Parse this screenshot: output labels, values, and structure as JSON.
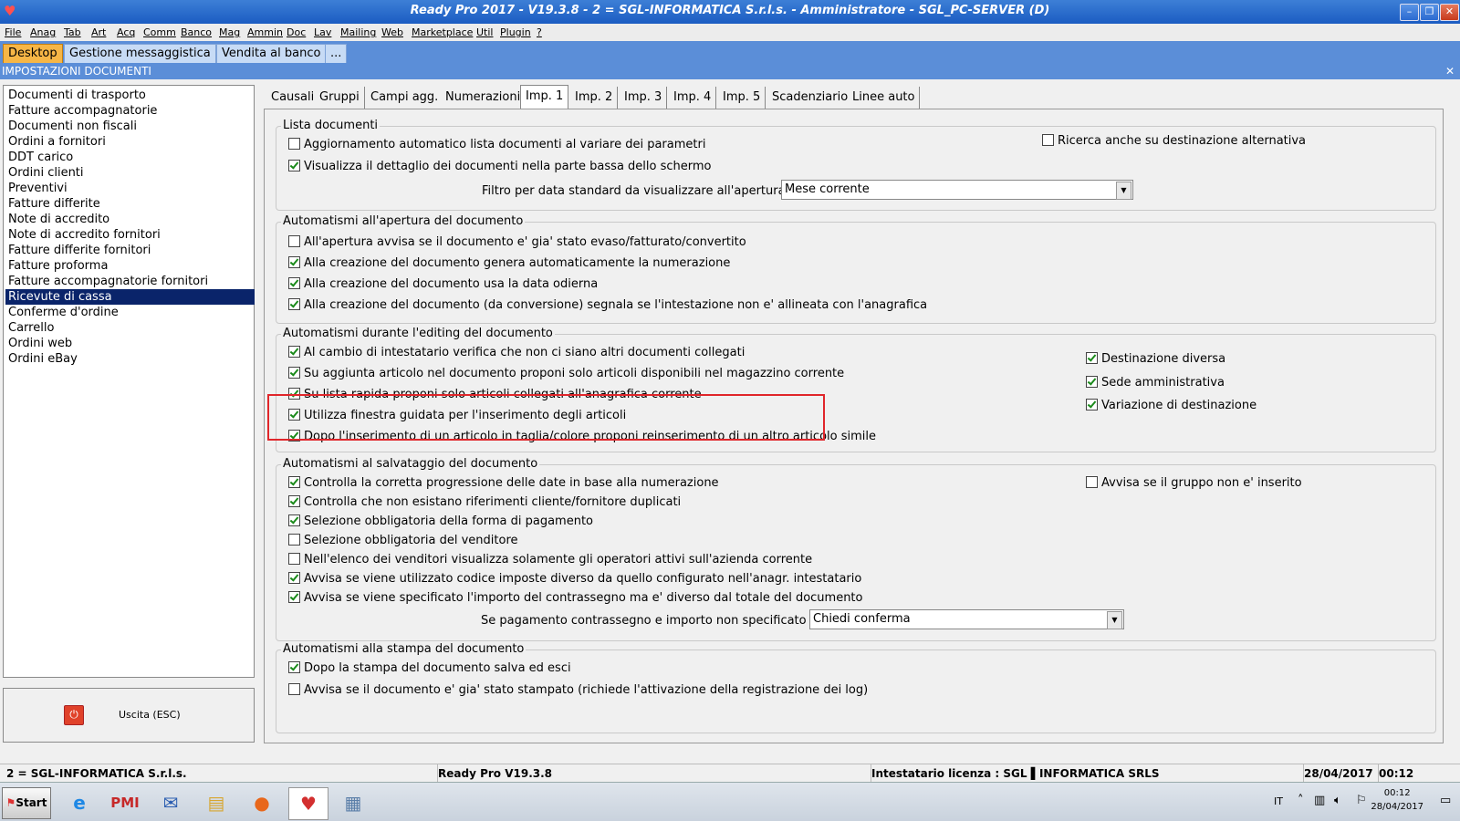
{
  "window": {
    "title": "Ready Pro 2017 - V19.3.8 - 2 = SGL-INFORMATICA S.r.l.s. - Amministratore - SGL_PC-SERVER (D)"
  },
  "menu": [
    "File",
    "Anag",
    "Tab",
    "Art",
    "Acq",
    "Comm",
    "Banco",
    "Mag",
    "Ammin",
    "Doc",
    "Lav",
    "Mailing",
    "Web",
    "Marketplace",
    "Util",
    "Plugin",
    "?"
  ],
  "top_tabs": [
    "Desktop",
    "Gestione messaggistica",
    "Vendita al banco",
    "..."
  ],
  "section_title": "IMPOSTAZIONI DOCUMENTI",
  "doc_list": [
    "Documenti di trasporto",
    "Fatture accompagnatorie",
    "Documenti non fiscali",
    "Ordini a fornitori",
    "DDT carico",
    "Ordini clienti",
    "Preventivi",
    "Fatture differite",
    "Note di accredito",
    "Note di accredito fornitori",
    "Fatture differite fornitori",
    "Fatture proforma",
    "Fatture accompagnatorie fornitori",
    "Ricevute di cassa",
    "Conferme d'ordine",
    "Carrello",
    "Ordini web",
    "Ordini eBay"
  ],
  "selected_doc": "Ricevute di cassa",
  "exit_label": "Uscita (ESC)",
  "panel_tabs": [
    "Causali",
    "Gruppi",
    "Campi agg.",
    "Numerazioni",
    "Imp. 1",
    "Imp. 2",
    "Imp. 3",
    "Imp. 4",
    "Imp. 5",
    "Scadenziario",
    "Linee auto"
  ],
  "groups": {
    "lista": {
      "label": "Lista documenti",
      "opts": [
        {
          "label": "Aggiornamento automatico lista documenti al variare dei parametri",
          "checked": false
        },
        {
          "label": "Visualizza il dettaglio dei documenti nella parte bassa dello schermo",
          "checked": true
        },
        {
          "label": "Ricerca anche su destinazione alternativa",
          "checked": false
        }
      ],
      "filter_label": "Filtro per data standard da visualizzare all'apertura :",
      "filter_value": "Mese corrente"
    },
    "apertura": {
      "label": "Automatismi all'apertura del documento",
      "opts": [
        {
          "label": "All'apertura avvisa se il documento e' gia' stato evaso/fatturato/convertito",
          "checked": false
        },
        {
          "label": "Alla creazione del documento genera automaticamente la numerazione",
          "checked": true
        },
        {
          "label": "Alla creazione del documento usa la data odierna",
          "checked": true
        },
        {
          "label": "Alla creazione del documento (da conversione) segnala se l'intestazione non e' allineata con l'anagrafica",
          "checked": true
        }
      ]
    },
    "editing": {
      "label": "Automatismi durante l'editing del documento",
      "opts": [
        {
          "label": "Al cambio di intestatario verifica che non ci siano altri documenti collegati",
          "checked": true
        },
        {
          "label": "Su aggiunta articolo nel documento proponi solo articoli disponibili nel magazzino corrente",
          "checked": true
        },
        {
          "label": "Su lista rapida proponi solo articoli collegati all'anagrafica corrente",
          "checked": true
        },
        {
          "label": "Utilizza finestra guidata per l'inserimento degli articoli",
          "checked": true
        },
        {
          "label": "Dopo l'inserimento di un articolo in taglia/colore proponi reinserimento di un altro articolo simile",
          "checked": true
        },
        {
          "label": "Destinazione diversa",
          "checked": true
        },
        {
          "label": "Sede amministrativa",
          "checked": true
        },
        {
          "label": "Variazione di destinazione",
          "checked": true
        }
      ]
    },
    "salvataggio": {
      "label": "Automatismi al salvataggio del documento",
      "opts": [
        {
          "label": "Controlla la corretta progressione delle date in base alla numerazione",
          "checked": true
        },
        {
          "label": "Controlla che non esistano riferimenti cliente/fornitore duplicati",
          "checked": true
        },
        {
          "label": "Selezione obbligatoria della forma di pagamento",
          "checked": true
        },
        {
          "label": "Selezione obbligatoria del venditore",
          "checked": false
        },
        {
          "label": "Nell'elenco dei venditori visualizza solamente gli operatori attivi sull'azienda corrente",
          "checked": false
        },
        {
          "label": "Avvisa se viene utilizzato codice imposte diverso da quello configurato nell'anagr. intestatario",
          "checked": true
        },
        {
          "label": "Avvisa se viene specificato l'importo del contrassegno ma e' diverso dal totale del documento",
          "checked": true
        },
        {
          "label": "Avvisa se il gruppo non e' inserito",
          "checked": false
        }
      ],
      "contr_label": "Se pagamento contrassegno e importo non specificato :",
      "contr_value": "Chiedi conferma"
    },
    "stampa": {
      "label": "Automatismi alla stampa del documento",
      "opts": [
        {
          "label": "Dopo la stampa del documento salva ed esci",
          "checked": true
        },
        {
          "label": "Avvisa se il documento e' gia' stato stampato (richiede l'attivazione della registrazione dei log)",
          "checked": false
        }
      ]
    }
  },
  "status": {
    "company": "2 = SGL-INFORMATICA S.r.l.s.",
    "version": "Ready Pro V19.3.8",
    "license": "Intestatario licenza : SGL ▌INFORMATICA SRLS",
    "date": "28/04/2017",
    "time": "00:12"
  },
  "taskbar": {
    "start": "Start",
    "apps": [
      {
        "name": "internet-explorer",
        "glyph": "e",
        "color": "#1e88e5"
      },
      {
        "name": "pmi",
        "glyph": "PMI",
        "color": "#c62828"
      },
      {
        "name": "thunderbird",
        "glyph": "✉",
        "color": "#2a5db0"
      },
      {
        "name": "file-explorer",
        "glyph": "▤",
        "color": "#d7a630"
      },
      {
        "name": "firefox",
        "glyph": "●",
        "color": "#e8671b"
      },
      {
        "name": "ready-pro",
        "glyph": "♥",
        "color": "#d32f2f"
      },
      {
        "name": "calculator",
        "glyph": "▦",
        "color": "#5a7ea8"
      }
    ],
    "lang": "IT",
    "clock_time": "00:12",
    "clock_date": "28/04/2017"
  }
}
